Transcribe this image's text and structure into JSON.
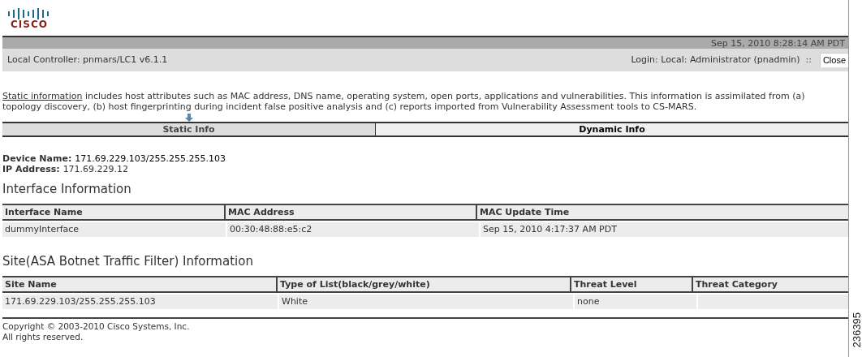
{
  "logo": {
    "text": "CISCO"
  },
  "header": {
    "timestamp": "Sep 15, 2010 8:28:14 AM PDT",
    "controller": "Local Controller: pnmars/LC1 v6.1.1",
    "login": "Login: Local: Administrator (pnadmin)  ::",
    "close_button": "Close"
  },
  "intro": {
    "link": "Static information",
    "text": " includes host attributes such as MAC address, DNS name, operating system, open ports, applications and vulnerabilities. This information is assimilated from (a) topology discovery, (b) host fingerprinting during incident false positive analysis and (c) reports imported from Vulnerability Assessment tools to CS-MARS."
  },
  "tabs": [
    {
      "label": "Static Info",
      "selected": true
    },
    {
      "label": "Dynamic Info",
      "selected": false
    }
  ],
  "device": [
    {
      "label": "Device Name:",
      "value": "171.69.229.103/255.255.255.103"
    },
    {
      "label": "IP Address:",
      "value": "171.69.229.12"
    }
  ],
  "interface_section": {
    "title": "Interface Information",
    "columns": [
      "Interface Name",
      "MAC Address",
      "MAC Update Time"
    ],
    "rows": [
      [
        "dummyInterface",
        "00:30:48:88:e5:c2",
        "Sep 15, 2010 4:17:37 AM PDT"
      ]
    ]
  },
  "site_section": {
    "title": "Site(ASA Botnet Traffic Filter) Information",
    "columns": [
      "Site Name",
      "Type of List(black/grey/white)",
      "Threat Level",
      "Threat Category"
    ],
    "rows": [
      [
        "171.69.229.103/255.255.255.103",
        "White",
        "none",
        ""
      ]
    ]
  },
  "footer": [
    "Copyright © 2003-2010 Cisco Systems, Inc.",
    "All rights reserved."
  ],
  "figure_number": "236395"
}
